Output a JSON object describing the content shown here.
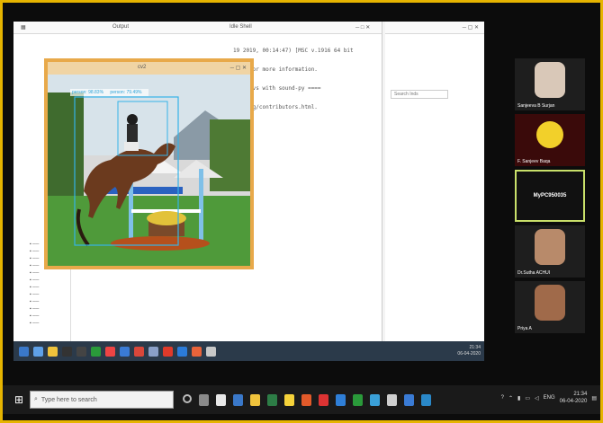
{
  "inner_window": {
    "left_title": "Output",
    "middle_title": "Idle Shell",
    "terminal_lines": [
      "19 2019, 00:14:47) [MSC v.1916 64 bit",
      "s()\" for more information.",
      "onsecsvs with sound-py ====",
      "www.org/contributors.html."
    ],
    "image_window_title": "cv2",
    "detection_labels": [
      "person: 98.83%",
      "person: 79.49%"
    ],
    "search_placeholder": "Search Inds"
  },
  "participants": [
    {
      "name": "Sanjeeva B Surjan",
      "type": "video"
    },
    {
      "name": "F. Sanjeev Baqa",
      "type": "emoji"
    },
    {
      "name": "MyPC950035",
      "type": "active"
    },
    {
      "name": "Dr.Sutha ACHUI",
      "type": "video"
    },
    {
      "name": "Priya A",
      "type": "video"
    }
  ],
  "taskbar": {
    "search_placeholder": "Type here to search",
    "language": "ENG",
    "time": "21:34",
    "date": "06-04-2020"
  },
  "inner_taskbar": {
    "time": "21:34",
    "date": "06-04-2020"
  },
  "colors": {
    "frame_border": "#e6b400",
    "image_window_border": "#e8a94a",
    "active_tile_border": "#c9e06a"
  }
}
